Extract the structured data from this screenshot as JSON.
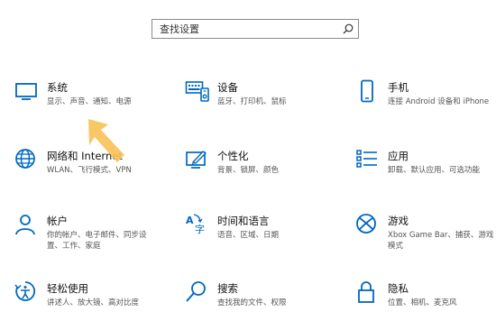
{
  "search": {
    "placeholder": "查找设置"
  },
  "tiles": [
    {
      "title": "系统",
      "desc": "显示、声音、通知、电源",
      "icon": "monitor-icon"
    },
    {
      "title": "设备",
      "desc": "蓝牙、打印机、鼠标",
      "icon": "keyboard-icon"
    },
    {
      "title": "手机",
      "desc": "连接 Android 设备和 iPhone",
      "icon": "phone-icon"
    },
    {
      "title": "网络和 Internet",
      "desc": "WLAN、飞行模式、VPN",
      "icon": "globe-icon"
    },
    {
      "title": "个性化",
      "desc": "背景、锁屏、颜色",
      "icon": "paint-icon"
    },
    {
      "title": "应用",
      "desc": "卸载、默认应用、可选功能",
      "icon": "apps-list-icon"
    },
    {
      "title": "帐户",
      "desc": "你的帐户、电子邮件、同步设置、工作、家庭",
      "icon": "person-icon"
    },
    {
      "title": "时间和语言",
      "desc": "语音、区域、日期",
      "icon": "language-icon"
    },
    {
      "title": "游戏",
      "desc": "Xbox Game Bar、捕获、游戏模式",
      "icon": "xbox-icon"
    },
    {
      "title": "轻松使用",
      "desc": "讲述人、放大镜、高对比度",
      "icon": "ease-of-access-icon"
    },
    {
      "title": "搜索",
      "desc": "查找我的文件、权限",
      "icon": "search-icon"
    },
    {
      "title": "隐私",
      "desc": "位置、相机、麦克风",
      "icon": "lock-icon"
    }
  ],
  "colors": {
    "accent": "#0067c0",
    "arrow": "#f7c35a"
  }
}
